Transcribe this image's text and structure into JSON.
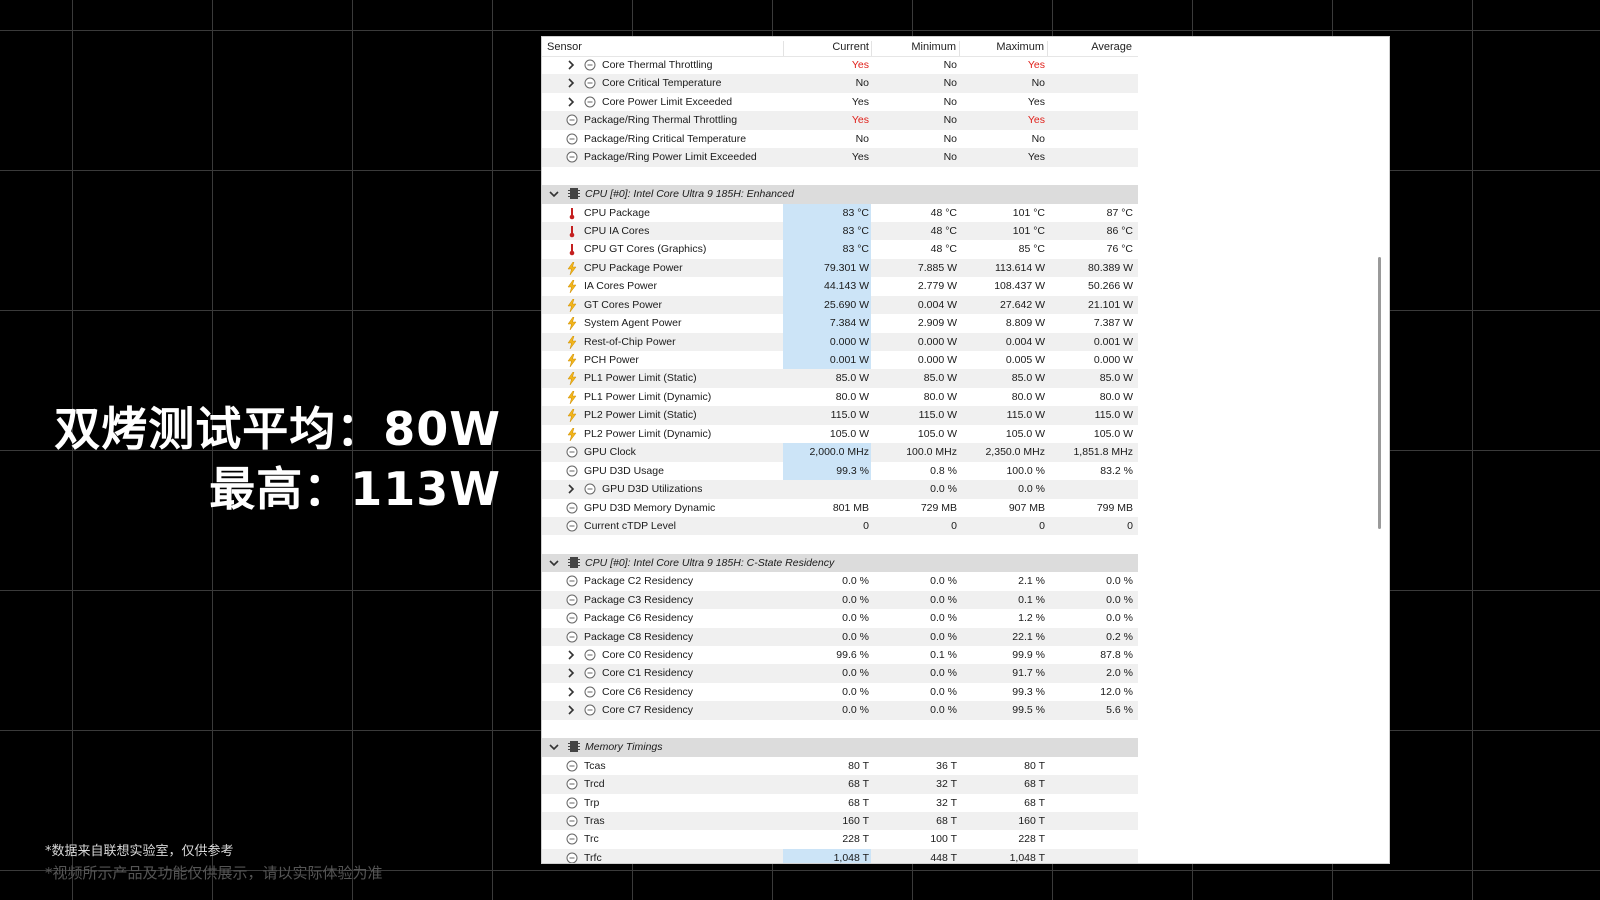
{
  "overlay": {
    "line1": "双烤测试平均：80W",
    "line2": "最高：113W",
    "footnote1": "*数据来自联想实验室，仅供参考",
    "footnote2": "*视频所示产品及功能仅供展示，请以实际体验为准"
  },
  "table": {
    "headers": {
      "sensor": "Sensor",
      "current": "Current",
      "minimum": "Minimum",
      "maximum": "Maximum",
      "average": "Average"
    },
    "rows": [
      {
        "kind": "item",
        "indent": 1,
        "expander": "collapsed",
        "icon": "circle",
        "label": "Core Thermal Throttling",
        "cur": "Yes",
        "min": "No",
        "max": "Yes",
        "avg": "",
        "red": [
          "cur",
          "max"
        ]
      },
      {
        "kind": "item",
        "indent": 1,
        "expander": "collapsed",
        "icon": "circle",
        "label": "Core Critical Temperature",
        "cur": "No",
        "min": "No",
        "max": "No",
        "avg": ""
      },
      {
        "kind": "item",
        "indent": 1,
        "expander": "collapsed",
        "icon": "circle",
        "label": "Core Power Limit Exceeded",
        "cur": "Yes",
        "min": "No",
        "max": "Yes",
        "avg": ""
      },
      {
        "kind": "item",
        "indent": 0,
        "icon": "circle",
        "label": "Package/Ring Thermal Throttling",
        "cur": "Yes",
        "min": "No",
        "max": "Yes",
        "avg": "",
        "red": [
          "cur",
          "max"
        ]
      },
      {
        "kind": "item",
        "indent": 0,
        "icon": "circle",
        "label": "Package/Ring Critical Temperature",
        "cur": "No",
        "min": "No",
        "max": "No",
        "avg": ""
      },
      {
        "kind": "item",
        "indent": 0,
        "icon": "circle",
        "label": "Package/Ring Power Limit Exceeded",
        "cur": "Yes",
        "min": "No",
        "max": "Yes",
        "avg": ""
      },
      {
        "kind": "blank"
      },
      {
        "kind": "group",
        "label": "CPU [#0]: Intel Core Ultra 9 185H: Enhanced"
      },
      {
        "kind": "item",
        "indent": 0,
        "icon": "thermometer",
        "label": "CPU Package",
        "cur": "83 °C",
        "min": "48 °C",
        "max": "101 °C",
        "avg": "87 °C",
        "hl": true
      },
      {
        "kind": "item",
        "indent": 0,
        "icon": "thermometer",
        "label": "CPU IA Cores",
        "cur": "83 °C",
        "min": "48 °C",
        "max": "101 °C",
        "avg": "86 °C",
        "hl": true
      },
      {
        "kind": "item",
        "indent": 0,
        "icon": "thermometer",
        "label": "CPU GT Cores (Graphics)",
        "cur": "83 °C",
        "min": "48 °C",
        "max": "85 °C",
        "avg": "76 °C",
        "hl": true
      },
      {
        "kind": "item",
        "indent": 0,
        "icon": "bolt",
        "label": "CPU Package Power",
        "cur": "79.301 W",
        "min": "7.885 W",
        "max": "113.614 W",
        "avg": "80.389 W",
        "hl": true
      },
      {
        "kind": "item",
        "indent": 0,
        "icon": "bolt",
        "label": "IA Cores Power",
        "cur": "44.143 W",
        "min": "2.779 W",
        "max": "108.437 W",
        "avg": "50.266 W",
        "hl": true
      },
      {
        "kind": "item",
        "indent": 0,
        "icon": "bolt",
        "label": "GT Cores Power",
        "cur": "25.690 W",
        "min": "0.004 W",
        "max": "27.642 W",
        "avg": "21.101 W",
        "hl": true
      },
      {
        "kind": "item",
        "indent": 0,
        "icon": "bolt",
        "label": "System Agent Power",
        "cur": "7.384 W",
        "min": "2.909 W",
        "max": "8.809 W",
        "avg": "7.387 W",
        "hl": true
      },
      {
        "kind": "item",
        "indent": 0,
        "icon": "bolt",
        "label": "Rest-of-Chip Power",
        "cur": "0.000 W",
        "min": "0.000 W",
        "max": "0.004 W",
        "avg": "0.001 W",
        "hl": true
      },
      {
        "kind": "item",
        "indent": 0,
        "icon": "bolt",
        "label": "PCH Power",
        "cur": "0.001 W",
        "min": "0.000 W",
        "max": "0.005 W",
        "avg": "0.000 W",
        "hl": true
      },
      {
        "kind": "item",
        "indent": 0,
        "icon": "bolt",
        "label": "PL1 Power Limit (Static)",
        "cur": "85.0 W",
        "min": "85.0 W",
        "max": "85.0 W",
        "avg": "85.0 W"
      },
      {
        "kind": "item",
        "indent": 0,
        "icon": "bolt",
        "label": "PL1 Power Limit (Dynamic)",
        "cur": "80.0 W",
        "min": "80.0 W",
        "max": "80.0 W",
        "avg": "80.0 W"
      },
      {
        "kind": "item",
        "indent": 0,
        "icon": "bolt",
        "label": "PL2 Power Limit (Static)",
        "cur": "115.0 W",
        "min": "115.0 W",
        "max": "115.0 W",
        "avg": "115.0 W"
      },
      {
        "kind": "item",
        "indent": 0,
        "icon": "bolt",
        "label": "PL2 Power Limit (Dynamic)",
        "cur": "105.0 W",
        "min": "105.0 W",
        "max": "105.0 W",
        "avg": "105.0 W"
      },
      {
        "kind": "item",
        "indent": 0,
        "icon": "circle",
        "label": "GPU Clock",
        "cur": "2,000.0 MHz",
        "min": "100.0 MHz",
        "max": "2,350.0 MHz",
        "avg": "1,851.8 MHz",
        "hl": true
      },
      {
        "kind": "item",
        "indent": 0,
        "icon": "circle",
        "label": "GPU D3D Usage",
        "cur": "99.3 %",
        "min": "0.8 %",
        "max": "100.0 %",
        "avg": "83.2 %",
        "hl": true
      },
      {
        "kind": "item",
        "indent": 1,
        "expander": "collapsed",
        "icon": "circle",
        "label": "GPU D3D Utilizations",
        "cur": "",
        "min": "0.0 %",
        "max": "0.0 %",
        "avg": ""
      },
      {
        "kind": "item",
        "indent": 0,
        "icon": "circle",
        "label": "GPU D3D Memory Dynamic",
        "cur": "801 MB",
        "min": "729 MB",
        "max": "907 MB",
        "avg": "799 MB"
      },
      {
        "kind": "item",
        "indent": 0,
        "icon": "circle",
        "label": "Current cTDP Level",
        "cur": "0",
        "min": "0",
        "max": "0",
        "avg": "0"
      },
      {
        "kind": "blank"
      },
      {
        "kind": "group",
        "label": "CPU [#0]: Intel Core Ultra 9 185H: C-State Residency"
      },
      {
        "kind": "item",
        "indent": 0,
        "icon": "circle",
        "label": "Package C2 Residency",
        "cur": "0.0 %",
        "min": "0.0 %",
        "max": "2.1 %",
        "avg": "0.0 %"
      },
      {
        "kind": "item",
        "indent": 0,
        "icon": "circle",
        "label": "Package C3 Residency",
        "cur": "0.0 %",
        "min": "0.0 %",
        "max": "0.1 %",
        "avg": "0.0 %"
      },
      {
        "kind": "item",
        "indent": 0,
        "icon": "circle",
        "label": "Package C6 Residency",
        "cur": "0.0 %",
        "min": "0.0 %",
        "max": "1.2 %",
        "avg": "0.0 %"
      },
      {
        "kind": "item",
        "indent": 0,
        "icon": "circle",
        "label": "Package C8 Residency",
        "cur": "0.0 %",
        "min": "0.0 %",
        "max": "22.1 %",
        "avg": "0.2 %"
      },
      {
        "kind": "item",
        "indent": 1,
        "expander": "collapsed",
        "icon": "circle",
        "label": "Core C0 Residency",
        "cur": "99.6 %",
        "min": "0.1 %",
        "max": "99.9 %",
        "avg": "87.8 %"
      },
      {
        "kind": "item",
        "indent": 1,
        "expander": "collapsed",
        "icon": "circle",
        "label": "Core C1 Residency",
        "cur": "0.0 %",
        "min": "0.0 %",
        "max": "91.7 %",
        "avg": "2.0 %"
      },
      {
        "kind": "item",
        "indent": 1,
        "expander": "collapsed",
        "icon": "circle",
        "label": "Core C6 Residency",
        "cur": "0.0 %",
        "min": "0.0 %",
        "max": "99.3 %",
        "avg": "12.0 %"
      },
      {
        "kind": "item",
        "indent": 1,
        "expander": "collapsed",
        "icon": "circle",
        "label": "Core C7 Residency",
        "cur": "0.0 %",
        "min": "0.0 %",
        "max": "99.5 %",
        "avg": "5.6 %"
      },
      {
        "kind": "blank"
      },
      {
        "kind": "group",
        "label": "Memory Timings"
      },
      {
        "kind": "item",
        "indent": 0,
        "icon": "circle",
        "label": "Tcas",
        "cur": "80 T",
        "min": "36 T",
        "max": "80 T",
        "avg": ""
      },
      {
        "kind": "item",
        "indent": 0,
        "icon": "circle",
        "label": "Trcd",
        "cur": "68 T",
        "min": "32 T",
        "max": "68 T",
        "avg": ""
      },
      {
        "kind": "item",
        "indent": 0,
        "icon": "circle",
        "label": "Trp",
        "cur": "68 T",
        "min": "32 T",
        "max": "68 T",
        "avg": ""
      },
      {
        "kind": "item",
        "indent": 0,
        "icon": "circle",
        "label": "Tras",
        "cur": "160 T",
        "min": "68 T",
        "max": "160 T",
        "avg": ""
      },
      {
        "kind": "item",
        "indent": 0,
        "icon": "circle",
        "label": "Trc",
        "cur": "228 T",
        "min": "100 T",
        "max": "228 T",
        "avg": ""
      },
      {
        "kind": "item",
        "indent": 0,
        "icon": "circle",
        "label": "Trfc",
        "cur": "1,048 T",
        "min": "448 T",
        "max": "1,048 T",
        "avg": "",
        "hl": true
      }
    ]
  },
  "colors": {
    "highlight": "#cce4f7",
    "alert": "#e0201a",
    "group": "#dcdcdc",
    "alt": "#f0f0f0"
  }
}
